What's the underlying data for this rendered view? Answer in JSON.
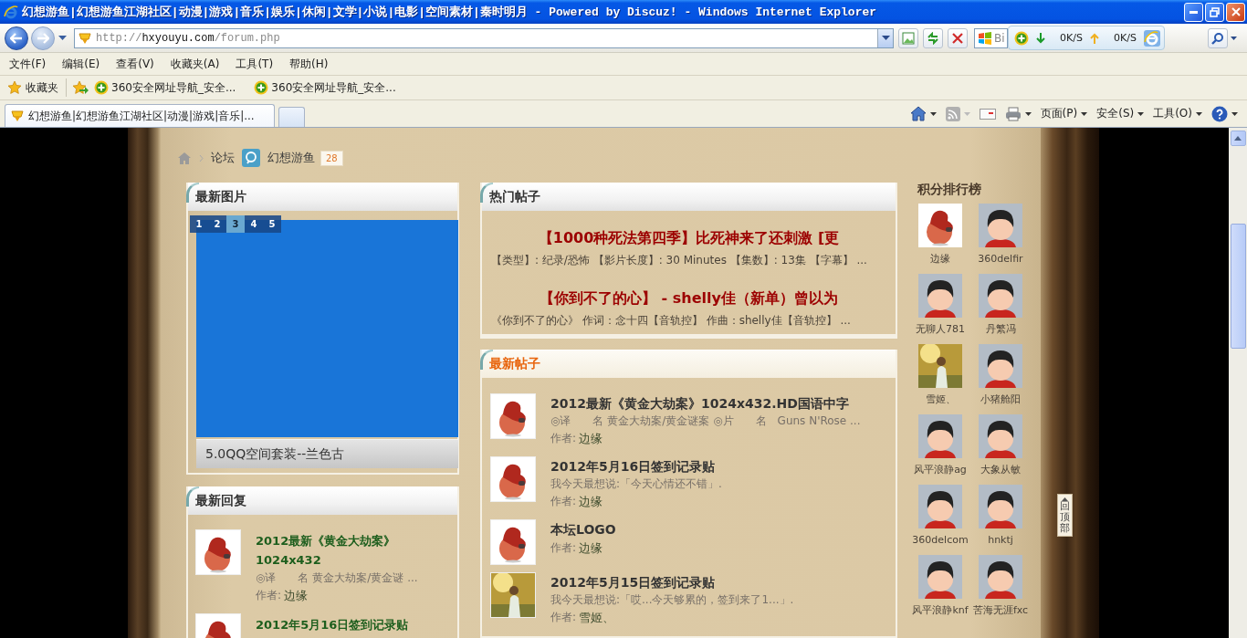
{
  "window": {
    "title": "幻想游鱼|幻想游鱼江湖社区|动漫|游戏|音乐|娱乐|休闲|文学|小说|电影|空间素材|秦时明月 - Powered by Discuz! - Windows Internet Explorer"
  },
  "address_bar": {
    "url": "http://**hxyouyu.com**/forum.php"
  },
  "search_field": {
    "value": "Bi"
  },
  "speed_widget": {
    "download": "0K/S",
    "upload": "0K/S"
  },
  "menu": [
    "文件(F)",
    "编辑(E)",
    "查看(V)",
    "收藏夹(A)",
    "工具(T)",
    "帮助(H)"
  ],
  "favorites_bar": {
    "label": "收藏夹",
    "links": [
      "360安全网址导航_安全...",
      "360安全网址导航_安全..."
    ]
  },
  "tabs": [
    {
      "label": "幻想游鱼|幻想游鱼江湖社区|动漫|游戏|音乐|...",
      "selected": true
    }
  ],
  "command_bar": [
    "页面(P)",
    "安全(S)",
    "工具(O)"
  ],
  "breadcrumb": {
    "items": [
      "论坛",
      "幻想游鱼"
    ],
    "count": "28"
  },
  "latest_images": {
    "title": "最新图片",
    "pages": [
      {
        "label": "1",
        "selected": false
      },
      {
        "label": "2",
        "selected": false
      },
      {
        "label": "3",
        "selected": true
      },
      {
        "label": "4",
        "selected": false
      },
      {
        "label": "5",
        "selected": false
      }
    ],
    "caption": "5.0QQ空间套装--兰色古"
  },
  "latest_replies": {
    "title": "最新回复",
    "items": [
      {
        "kind": "ball",
        "title": "2012最新《黄金大劫案》1024x432",
        "summary": "◎译　　名 黄金大劫案/黄金谜 ...",
        "author_label": "作者:",
        "author": "边缘"
      },
      {
        "kind": "ball",
        "title": "2012年5月16日签到记录贴"
      }
    ]
  },
  "hot_threads": {
    "title": "热门帖子",
    "items": [
      {
        "title": "【1000种死法第四季】比死神来了还刺激 [更",
        "summary": "【类型】: 纪录/恐怖 【影片长度】: 30 Minutes 【集数】: 13集 【字幕】 ..."
      },
      {
        "title": "【你到不了的心】 - shelly佳（新单）曾以为",
        "summary": "《你到不了的心》 作词：念十四【音轨控】 作曲：shelly佳【音轨控】 ..."
      }
    ]
  },
  "latest_threads": {
    "title": "最新帖子",
    "items": [
      {
        "kind": "ball",
        "title": "2012最新《黄金大劫案》1024x432.HD国语中字",
        "summary": "◎译　　名 黄金大劫案/黄金谜案 ◎片　　名　Guns N'Rose ...",
        "author_label": "作者:",
        "author": "边缘"
      },
      {
        "kind": "ball",
        "title": "2012年5月16日签到记录贴",
        "summary": "我今天最想说:「今天心情还不错」.",
        "author_label": "作者:",
        "author": "边缘"
      },
      {
        "kind": "ball",
        "title": "本坛LOGO",
        "author_label": "作者:",
        "author": "边缘"
      },
      {
        "title": "2012年5月15日签到记录贴",
        "summary": "我今天最想说:「哎...今天够累的，签到来了1...」.",
        "author_label": "作者:",
        "author": "雪姬、"
      }
    ]
  },
  "ranking": {
    "title": "积分排行榜",
    "users": [
      {
        "kind": "ball",
        "name": "边缘"
      },
      {
        "kind": "default",
        "name": "360delfir"
      },
      {
        "kind": "default",
        "name": "无聊人781"
      },
      {
        "kind": "default",
        "name": "丹繁冯"
      },
      {
        "name": "雪姬、"
      },
      {
        "kind": "default",
        "name": "小猪舱阳"
      },
      {
        "kind": "default",
        "name": "风平浪静ag"
      },
      {
        "kind": "default",
        "name": "大象从敏"
      },
      {
        "kind": "default",
        "name": "360delcom"
      },
      {
        "kind": "default",
        "name": "hnktj"
      },
      {
        "kind": "default",
        "name": "风平浪静knf"
      },
      {
        "kind": "default",
        "name": "苦海无涯fxc"
      }
    ]
  },
  "back_to_top": "回顶部"
}
